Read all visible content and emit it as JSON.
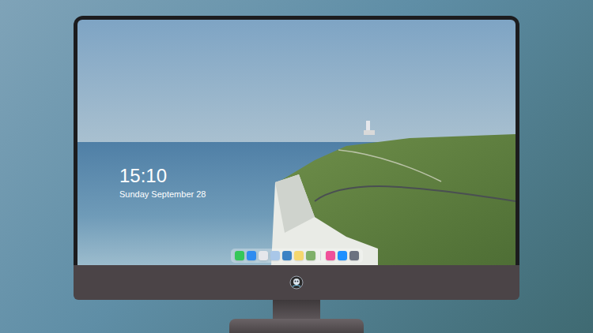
{
  "lock_screen": {
    "time": "15:10",
    "date": "Sunday September 28"
  },
  "dock": {
    "items": [
      {
        "kind": "app",
        "color": "#34c759"
      },
      {
        "kind": "app",
        "color": "#2f8cf0"
      },
      {
        "kind": "app",
        "color": "#e5e7eb"
      },
      {
        "kind": "app",
        "color": "#a9c7e8"
      },
      {
        "kind": "app",
        "color": "#3b82c4"
      },
      {
        "kind": "app",
        "color": "#f5d76e"
      },
      {
        "kind": "app",
        "color": "#7fb069"
      },
      {
        "kind": "separator",
        "color": "#d1d5db"
      },
      {
        "kind": "app",
        "color": "#f0509a"
      },
      {
        "kind": "app",
        "color": "#1e90ff"
      },
      {
        "kind": "app",
        "color": "#6b7280"
      }
    ]
  }
}
